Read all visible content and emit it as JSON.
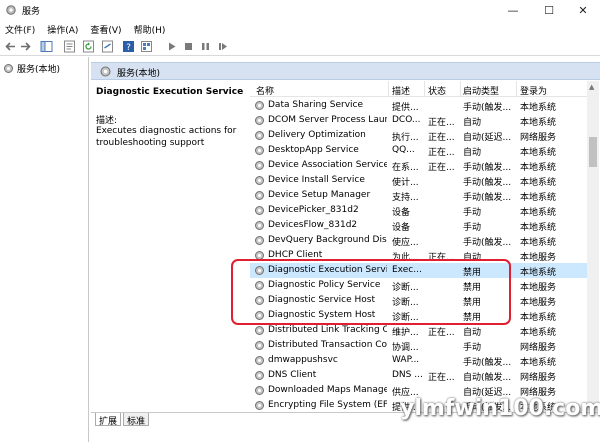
{
  "window": {
    "title": "服务"
  },
  "menu": [
    "文件(F)",
    "操作(A)",
    "查看(V)",
    "帮助(H)"
  ],
  "tree": {
    "root_label": "服务(本地)"
  },
  "main": {
    "header_title": "服务(本地)",
    "selected_service_name": "Diagnostic Execution Service",
    "description_label": "描述:",
    "description_text": "Executes diagnostic actions for troubleshooting support"
  },
  "columns": {
    "name": "名称",
    "description": "描述",
    "status": "状态",
    "startup": "启动类型",
    "logon": "登录为"
  },
  "services": [
    {
      "name": "Data Sharing Service",
      "description": "提供...",
      "status": "",
      "startup": "手动(触发...",
      "logon": "本地系统"
    },
    {
      "name": "DCOM Server Process Laun...",
      "description": "DCO...",
      "status": "正在...",
      "startup": "自动",
      "logon": "本地系统"
    },
    {
      "name": "Delivery Optimization",
      "description": "执行...",
      "status": "正在...",
      "startup": "自动(延迟...",
      "logon": "网络服务"
    },
    {
      "name": "DesktopApp Service",
      "description": "QQ...",
      "status": "正在...",
      "startup": "自动",
      "logon": "本地系统"
    },
    {
      "name": "Device Association Service",
      "description": "在系...",
      "status": "正在...",
      "startup": "手动(触发...",
      "logon": "本地系统"
    },
    {
      "name": "Device Install Service",
      "description": "使计...",
      "status": "",
      "startup": "手动(触发...",
      "logon": "本地系统"
    },
    {
      "name": "Device Setup Manager",
      "description": "支持...",
      "status": "",
      "startup": "手动(触发...",
      "logon": "本地系统"
    },
    {
      "name": "DevicePicker_831d2",
      "description": "设备",
      "status": "",
      "startup": "手动",
      "logon": "本地系统"
    },
    {
      "name": "DevicesFlow_831d2",
      "description": "设备",
      "status": "",
      "startup": "手动",
      "logon": "本地系统"
    },
    {
      "name": "DevQuery Background Disc...",
      "description": "使应...",
      "status": "",
      "startup": "手动(触发...",
      "logon": "本地系统"
    },
    {
      "name": "DHCP Client",
      "description": "为此...",
      "status": "正在...",
      "startup": "自动",
      "logon": "本地服务"
    },
    {
      "name": "Diagnostic Execution Service",
      "description": "Exec...",
      "status": "",
      "startup": "禁用",
      "logon": "本地系统",
      "selected": true
    },
    {
      "name": "Diagnostic Policy Service",
      "description": "诊断...",
      "status": "",
      "startup": "禁用",
      "logon": "本地服务"
    },
    {
      "name": "Diagnostic Service Host",
      "description": "诊断...",
      "status": "",
      "startup": "禁用",
      "logon": "本地服务"
    },
    {
      "name": "Diagnostic System Host",
      "description": "诊断...",
      "status": "",
      "startup": "禁用",
      "logon": "本地系统"
    },
    {
      "name": "Distributed Link Tracking Cl...",
      "description": "维护...",
      "status": "正在...",
      "startup": "自动",
      "logon": "本地系统"
    },
    {
      "name": "Distributed Transaction Coo...",
      "description": "协调...",
      "status": "",
      "startup": "手动",
      "logon": "网络服务"
    },
    {
      "name": "dmwappushsvc",
      "description": "WAP...",
      "status": "",
      "startup": "手动(触发...",
      "logon": "本地系统"
    },
    {
      "name": "DNS Client",
      "description": "DNS ...",
      "status": "正在...",
      "startup": "自动(触发...",
      "logon": "网络服务"
    },
    {
      "name": "Downloaded Maps Manager",
      "description": "供应...",
      "status": "",
      "startup": "自动(延迟...",
      "logon": "网络服务"
    },
    {
      "name": "Encrypting File System (EFS)",
      "description": "提供...",
      "status": "",
      "startup": "手动(触发...",
      "logon": "本地系统"
    }
  ],
  "tabs": [
    "扩展",
    "标准"
  ],
  "watermark": "ylmfwin100.com",
  "colors": {
    "header_bg": "#d6e2f1",
    "selected_row_bg": "#cce8ff",
    "highlight_border": "#e02030"
  }
}
